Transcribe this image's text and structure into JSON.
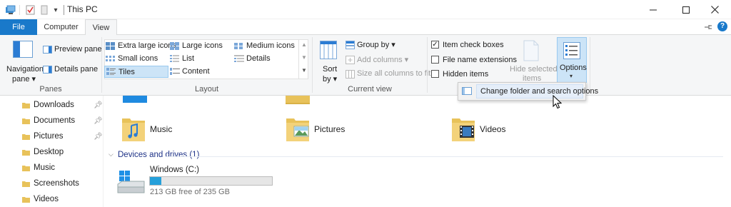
{
  "window": {
    "title": "This PC",
    "quick_access_glyph": "▾"
  },
  "tabs": [
    {
      "label": "File"
    },
    {
      "label": "Computer"
    },
    {
      "label": "View"
    }
  ],
  "ribbon": {
    "panes": {
      "navigation_pane_label": "Navigation",
      "navigation_pane_label2": "pane",
      "preview_pane": "Preview pane",
      "details_pane": "Details pane",
      "group_label": "Panes"
    },
    "layout": {
      "items": [
        {
          "label": "Extra large icons"
        },
        {
          "label": "Large icons"
        },
        {
          "label": "Medium icons"
        },
        {
          "label": "Small icons"
        },
        {
          "label": "List"
        },
        {
          "label": "Details"
        },
        {
          "label": "Tiles"
        },
        {
          "label": "Content"
        }
      ],
      "group_label": "Layout"
    },
    "current_view": {
      "sort_by": "Sort",
      "sort_by2": "by",
      "group_by": "Group by",
      "add_columns": "Add columns",
      "size_all_columns": "Size all columns to fit",
      "group_label": "Current view"
    },
    "show_hide": {
      "item_check_boxes": "Item check boxes",
      "item_check_boxes_checked": true,
      "file_name_extensions": "File name extensions",
      "hidden_items": "Hidden items",
      "hide_selected": "Hide selected",
      "hide_selected2": "items"
    },
    "options": {
      "label": "Options",
      "menu_item": "Change folder and search options"
    }
  },
  "nav_pane": {
    "items": [
      {
        "label": "Downloads",
        "pinned": true
      },
      {
        "label": "Documents",
        "pinned": true
      },
      {
        "label": "Pictures",
        "pinned": true
      },
      {
        "label": "Desktop",
        "pinned": false
      },
      {
        "label": "Music",
        "pinned": false
      },
      {
        "label": "Screenshots",
        "pinned": false
      },
      {
        "label": "Videos",
        "pinned": false
      }
    ]
  },
  "folders": [
    {
      "label": "Music"
    },
    {
      "label": "Pictures"
    },
    {
      "label": "Videos"
    }
  ],
  "devices": {
    "header": "Devices and drives (1)",
    "drive": {
      "name": "Windows (C:)",
      "free_text": "213 GB free of 235 GB",
      "used_fraction": 0.094
    }
  },
  "colors": {
    "accent": "#1979ca",
    "folder": "#e8c25a",
    "drive_bar": "#26a0da"
  }
}
